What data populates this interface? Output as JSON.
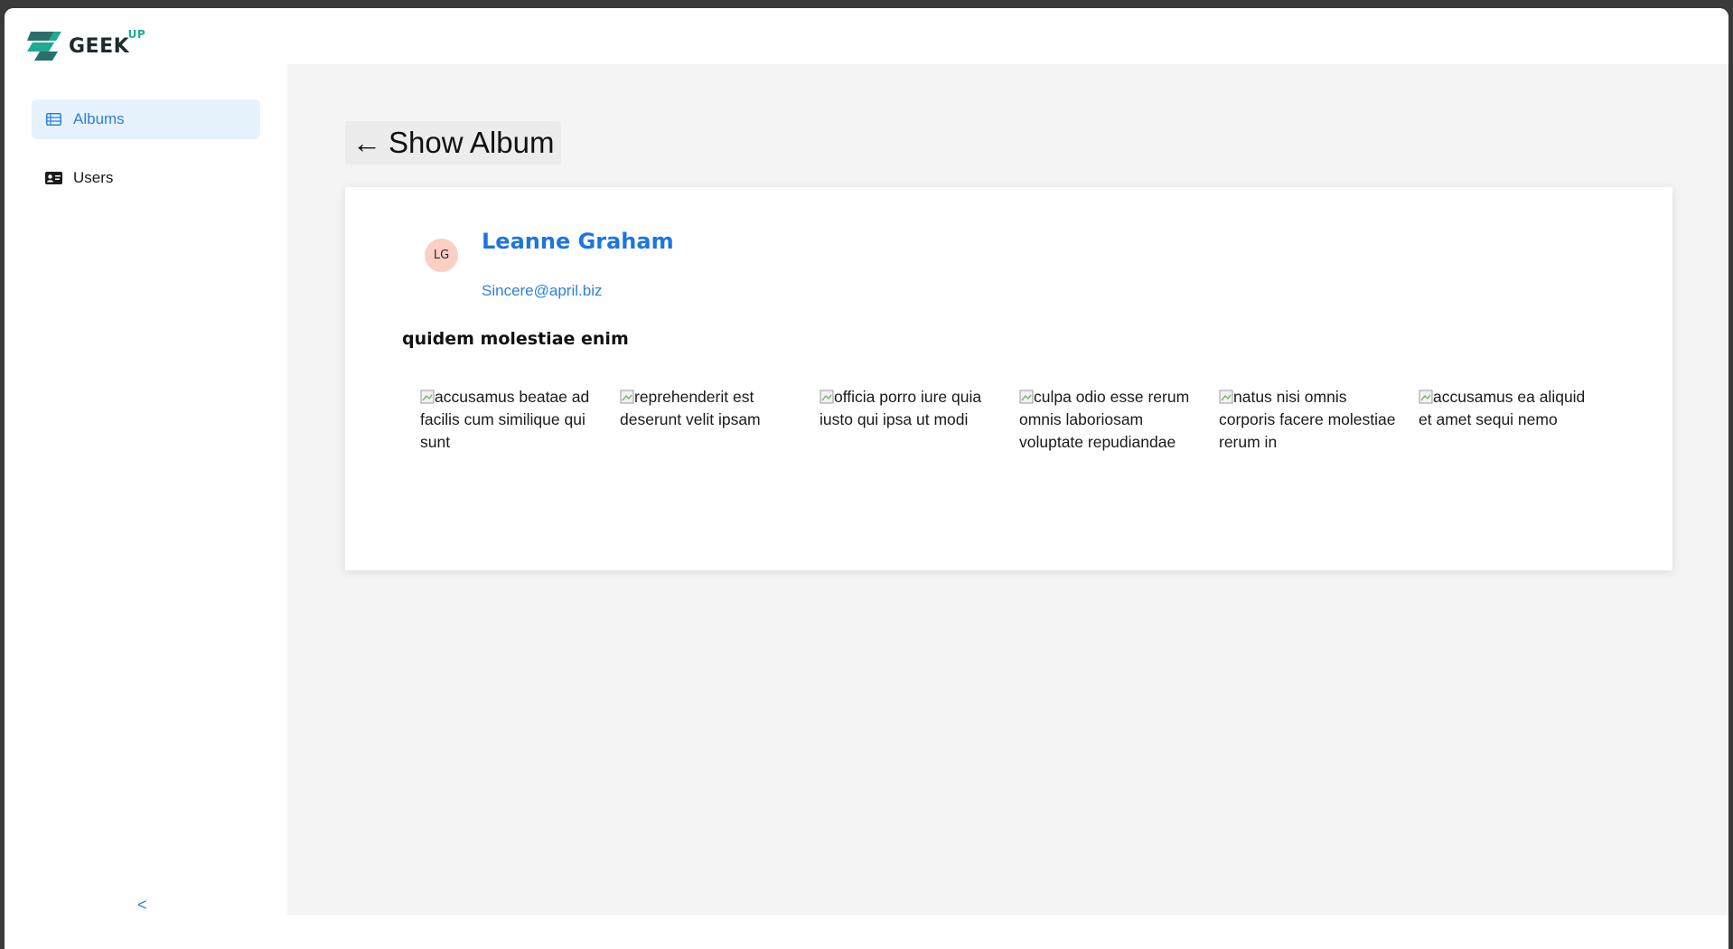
{
  "app": {
    "brand_text": "GEEK",
    "brand_sup": "UP"
  },
  "sidebar": {
    "items": [
      {
        "label": "Albums",
        "icon": "table-list-icon",
        "active": true
      },
      {
        "label": "Users",
        "icon": "id-card-icon",
        "active": false
      }
    ],
    "collapse_label": "<"
  },
  "page": {
    "back_arrow": "←",
    "title": "Show Album"
  },
  "user": {
    "initials": "LG",
    "name": "Leanne Graham",
    "email": "Sincere@april.biz"
  },
  "album": {
    "title": "quidem molestiae enim",
    "photos": [
      {
        "alt": "accusamus beatae ad facilis cum similique qui sunt"
      },
      {
        "alt": "reprehenderit est deserunt velit ipsam"
      },
      {
        "alt": "officia porro iure quia iusto qui ipsa ut modi"
      },
      {
        "alt": "culpa odio esse rerum omnis laboriosam voluptate repudiandae"
      },
      {
        "alt": "natus nisi omnis corporis facere molestiae rerum in"
      },
      {
        "alt": "accusamus ea aliquid et amet sequi nemo"
      }
    ]
  },
  "colors": {
    "accent": "#1d74e4",
    "active_bg": "#e6f3fd",
    "content_bg": "#f4f4f4",
    "avatar_bg": "#fbcfc4",
    "brand_teal": "#1faa94"
  }
}
